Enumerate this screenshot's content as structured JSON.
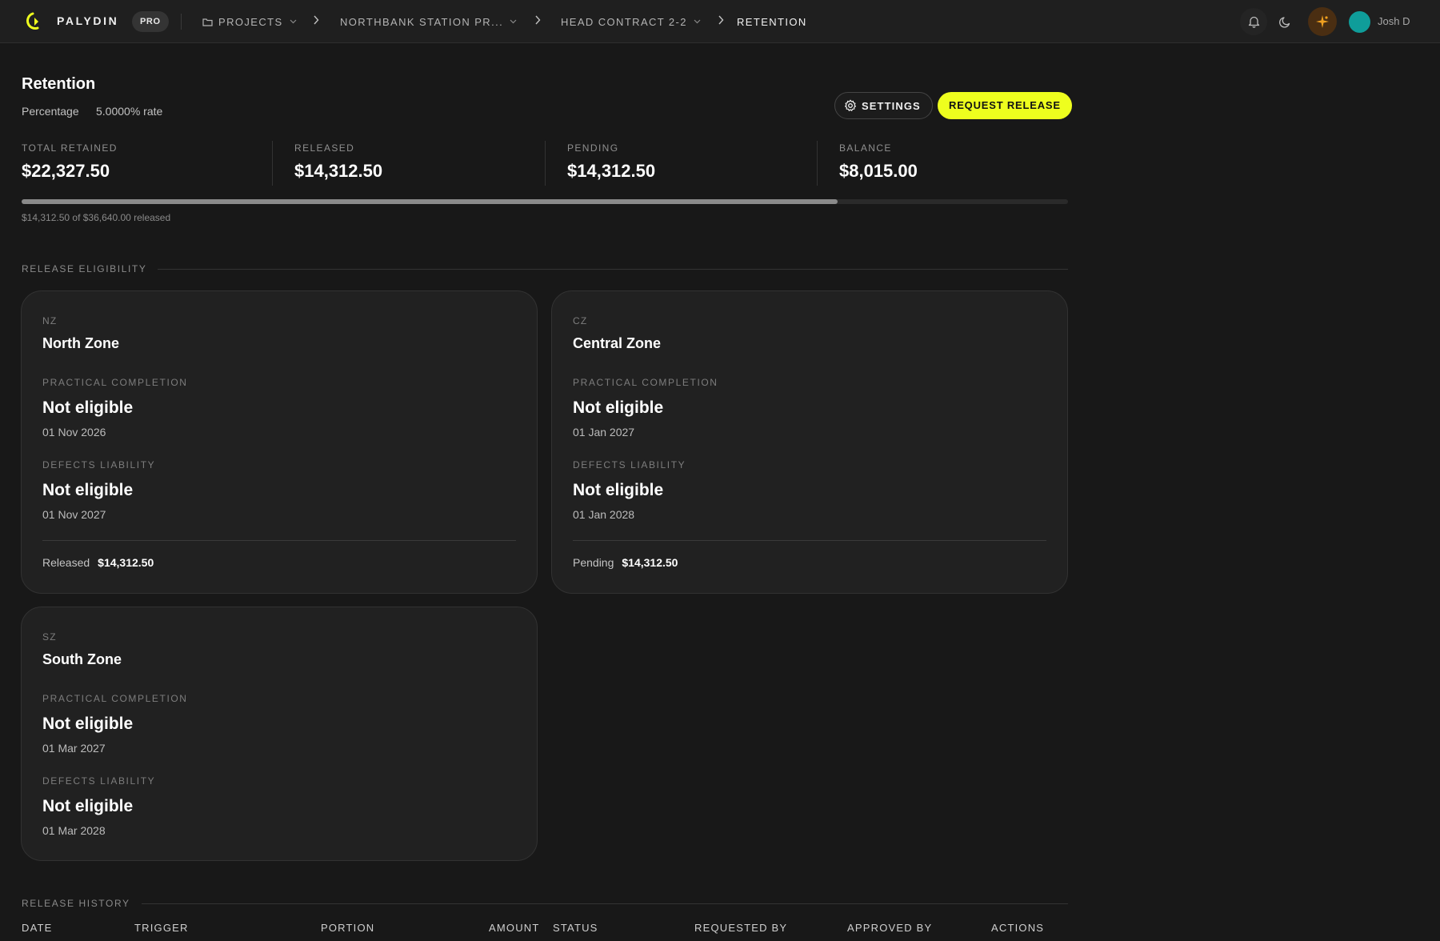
{
  "topbar": {
    "brand": "PALYDIN",
    "badge": "PRO",
    "breadcrumbs": [
      {
        "label": "PROJECTS"
      },
      {
        "label": "NORTHBANK STATION PR..."
      },
      {
        "label": "HEAD CONTRACT 2-2"
      },
      {
        "label": "RETENTION"
      }
    ],
    "user_name": "Josh D",
    "colors": {
      "brand_yellow": "#eefe1e",
      "spark": "#f0a020",
      "avatar": "#0f9d9a"
    }
  },
  "header": {
    "title": "Retention",
    "method": "Percentage",
    "rate": "5.0000% rate",
    "settings_label": "SETTINGS",
    "request_release_label": "REQUEST RELEASE"
  },
  "stats": [
    {
      "label": "TOTAL RETAINED",
      "value": "$22,327.50"
    },
    {
      "label": "RELEASED",
      "value": "$14,312.50"
    },
    {
      "label": "PENDING",
      "value": "$14,312.50"
    },
    {
      "label": "BALANCE",
      "value": "$8,015.00"
    }
  ],
  "progress": {
    "fraction": 0.78,
    "caption": "$14,312.50 of $36,640.00 released"
  },
  "eligibility": {
    "section_title": "RELEASE ELIGIBILITY",
    "labels": {
      "practical": "PRACTICAL COMPLETION",
      "defects": "DEFECTS LIABILITY"
    },
    "zones": [
      {
        "code": "NZ",
        "name": "North Zone",
        "practical_status": "Not eligible",
        "practical_date": "01 Nov 2026",
        "defects_status": "Not eligible",
        "defects_date": "01 Nov 2027",
        "footer_label": "Released",
        "footer_value": "$14,312.50"
      },
      {
        "code": "CZ",
        "name": "Central Zone",
        "practical_status": "Not eligible",
        "practical_date": "01 Jan 2027",
        "defects_status": "Not eligible",
        "defects_date": "01 Jan 2028",
        "footer_label": "Pending",
        "footer_value": "$14,312.50"
      },
      {
        "code": "SZ",
        "name": "South Zone",
        "practical_status": "Not eligible",
        "practical_date": "01 Mar 2027",
        "defects_status": "Not eligible",
        "defects_date": "01 Mar 2028"
      }
    ]
  },
  "history": {
    "section_title": "RELEASE HISTORY",
    "columns": [
      "DATE",
      "TRIGGER",
      "PORTION",
      "AMOUNT",
      "STATUS",
      "REQUESTED BY",
      "APPROVED BY",
      "ACTIONS"
    ]
  }
}
